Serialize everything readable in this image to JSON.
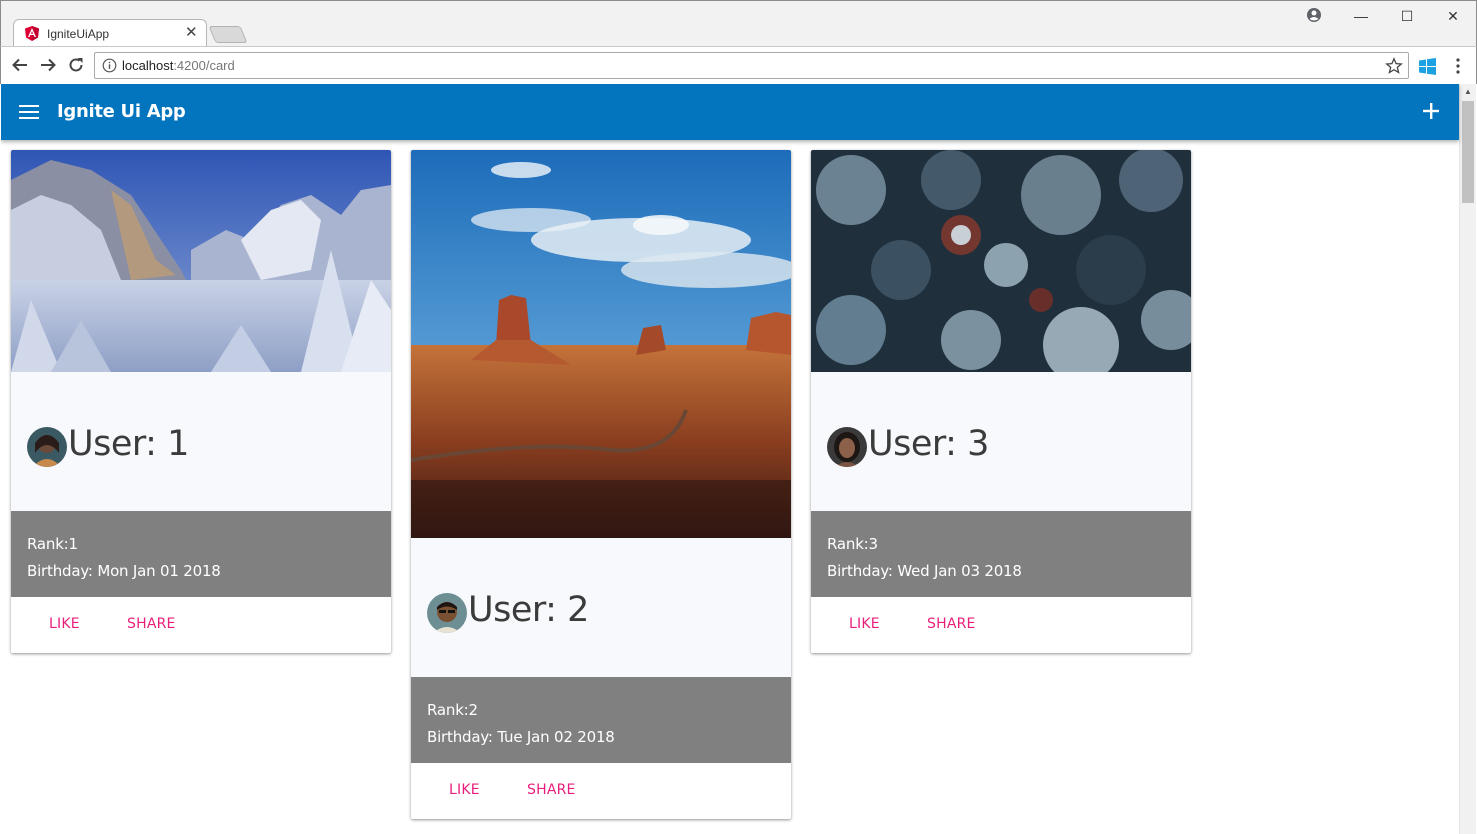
{
  "browser": {
    "tab_title": "IgniteUiApp",
    "tab_close": "✕",
    "url_host": "localhost",
    "url_path": ":4200/card",
    "window_minimize": "—",
    "window_maximize": "☐",
    "window_close": "✕"
  },
  "app": {
    "title": "Ignite Ui App",
    "accent_color": "#0375be",
    "action_color": "#e91e7c"
  },
  "cards": [
    {
      "title": "User: 1",
      "rank": "Rank:1",
      "birthday": "Birthday: Mon Jan 01 2018",
      "like_label": "LIKE",
      "share_label": "SHARE"
    },
    {
      "title": "User: 2",
      "rank": "Rank:2",
      "birthday": "Birthday: Tue Jan 02 2018",
      "like_label": "LIKE",
      "share_label": "SHARE"
    },
    {
      "title": "User: 3",
      "rank": "Rank:3",
      "birthday": "Birthday: Wed Jan 03 2018",
      "like_label": "LIKE",
      "share_label": "SHARE"
    }
  ]
}
